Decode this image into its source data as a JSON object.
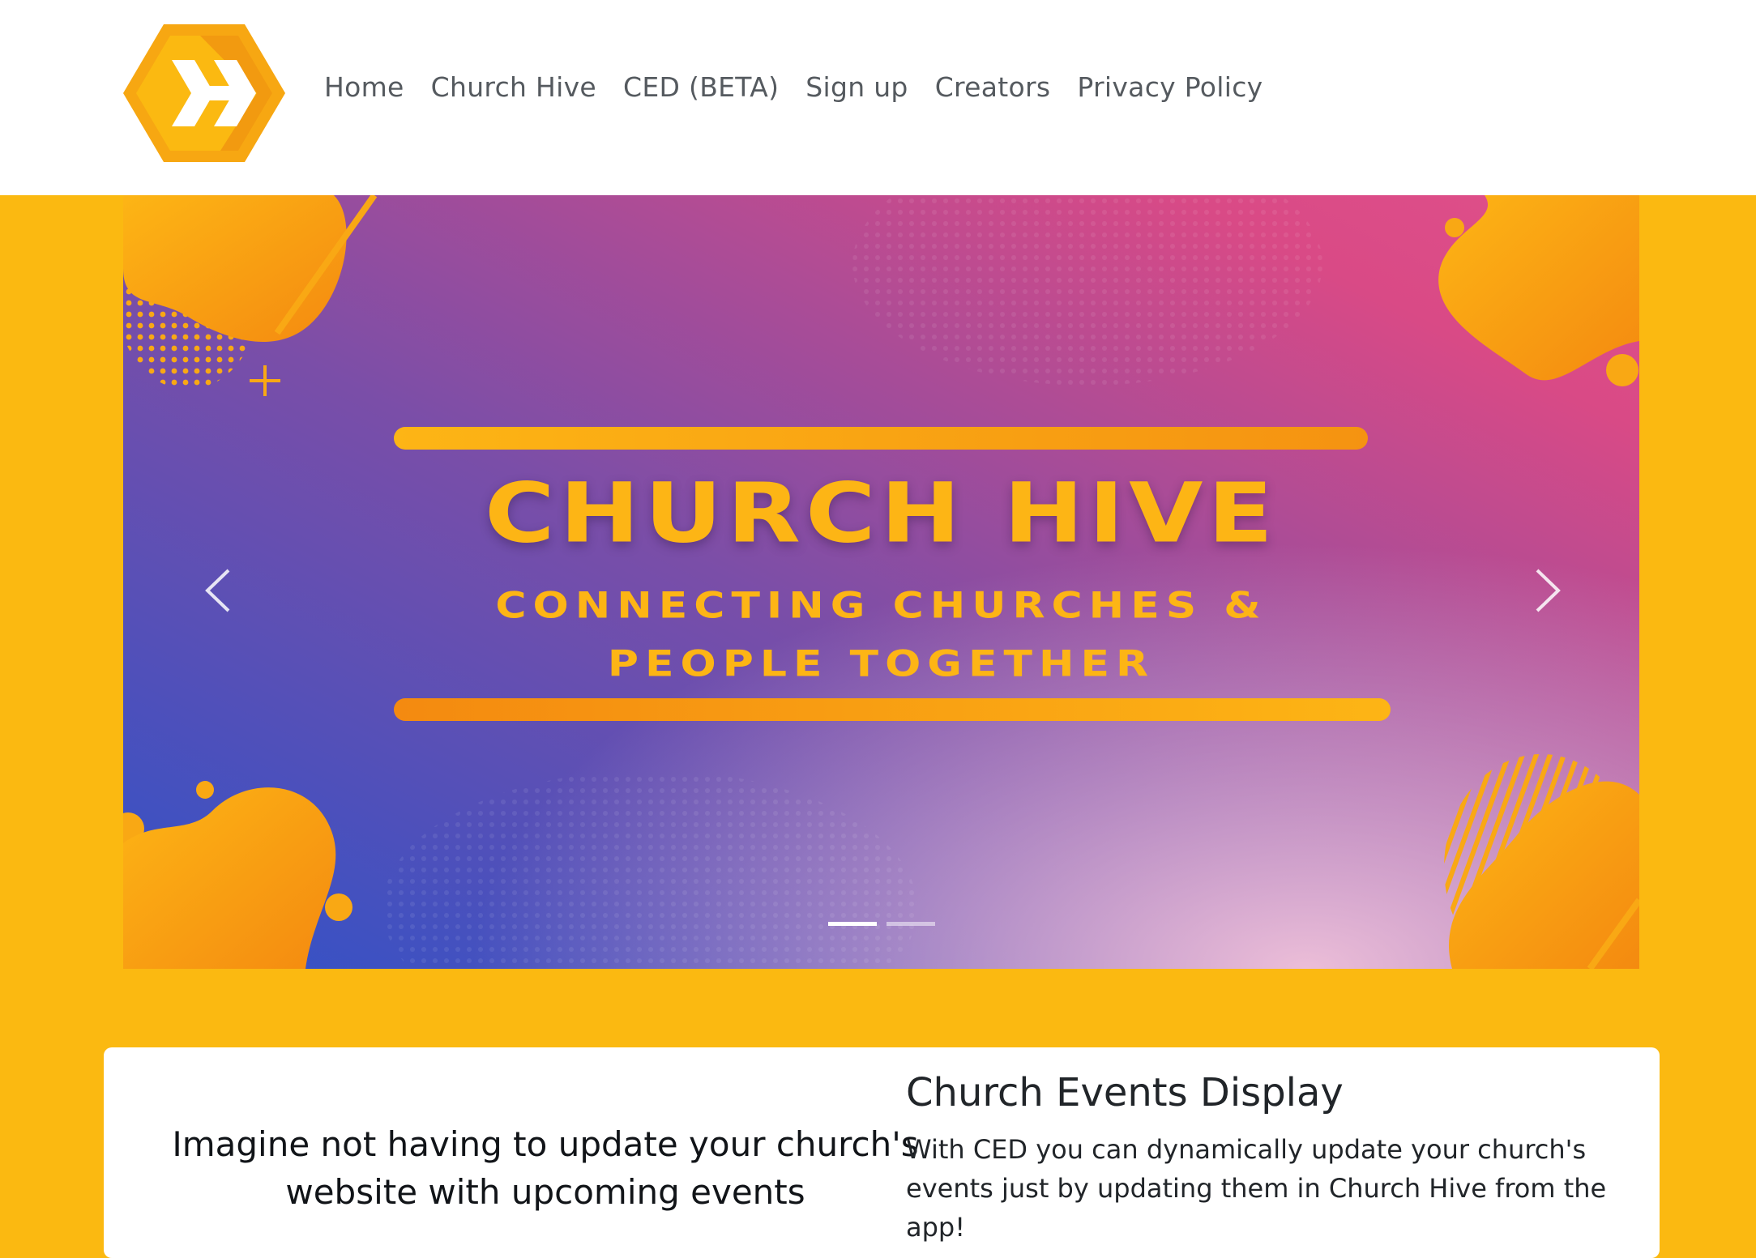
{
  "brand": {
    "logo_icon": "church-hive-hexagon-logo",
    "primary_color": "#fbb911",
    "accent_color": "#f48a10"
  },
  "nav": {
    "items": [
      {
        "label": "Home"
      },
      {
        "label": "Church Hive"
      },
      {
        "label": "CED (BETA)"
      },
      {
        "label": "Sign up"
      },
      {
        "label": "Creators"
      },
      {
        "label": "Privacy Policy"
      }
    ]
  },
  "carousel": {
    "slides_count": 2,
    "active_index": 0,
    "slide": {
      "title": "CHURCH HIVE",
      "subtitle_line1": "CONNECTING  CHURCHES &",
      "subtitle_line2": "PEOPLE TOGETHER"
    },
    "prev_icon": "chevron-left-icon",
    "next_icon": "chevron-right-icon",
    "gradient_colors": [
      "#2f52c8",
      "#7a4ea8",
      "#d94a86",
      "#e6a3c6"
    ]
  },
  "info": {
    "tagline": "Imagine not having to update your church's website with upcoming events",
    "title": "Church Events Display",
    "description": "With CED you can dynamically update your church's events just by updating them in Church Hive from the app!"
  }
}
